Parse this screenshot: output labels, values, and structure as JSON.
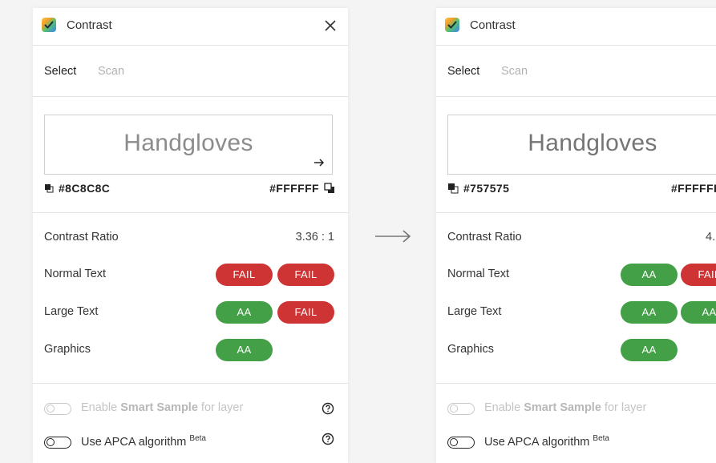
{
  "panels": [
    {
      "title": "Contrast",
      "tabs": [
        "Select",
        "Scan"
      ],
      "preview_text": "Handgloves",
      "preview_color": "#8C8C8C",
      "foreground": "#8C8C8C",
      "background": "#FFFFFF",
      "ratio_label": "Contrast Ratio",
      "ratio_value": "3.36 : 1",
      "rows": [
        {
          "label": "Normal Text",
          "badges": [
            "FAIL",
            "FAIL"
          ]
        },
        {
          "label": "Large Text",
          "badges": [
            "AA",
            "FAIL"
          ]
        },
        {
          "label": "Graphics",
          "badges": [
            "AA"
          ]
        }
      ],
      "opt1_pre": "Enable ",
      "opt1_bold": "Smart Sample",
      "opt1_post": " for layer",
      "opt2": "Use APCA algorithm ",
      "opt2_sup": "Beta"
    },
    {
      "title": "Contrast",
      "tabs": [
        "Select",
        "Scan"
      ],
      "preview_text": "Handgloves",
      "preview_color": "#757575",
      "foreground": "#757575",
      "background": "#FFFFFF",
      "ratio_label": "Contrast Ratio",
      "ratio_value": "4.",
      "rows": [
        {
          "label": "Normal Text",
          "badges": [
            "AA",
            "FAIL"
          ]
        },
        {
          "label": "Large Text",
          "badges": [
            "AA",
            "AA"
          ]
        },
        {
          "label": "Graphics",
          "badges": [
            "AA"
          ]
        }
      ],
      "opt1_pre": "Enable ",
      "opt1_bold": "Smart Sample",
      "opt1_post": " for layer",
      "opt2": "Use APCA algorithm ",
      "opt2_sup": "Beta"
    }
  ],
  "colors": {
    "pass": "#43a047",
    "fail": "#cf3434",
    "disabled": "#c4c4c4"
  },
  "icons": [
    "app-logo-icon",
    "close-icon",
    "swap-arrow-icon",
    "foreground-swatch-icon",
    "background-swatch-icon",
    "help-icon",
    "arrow-right-icon"
  ]
}
